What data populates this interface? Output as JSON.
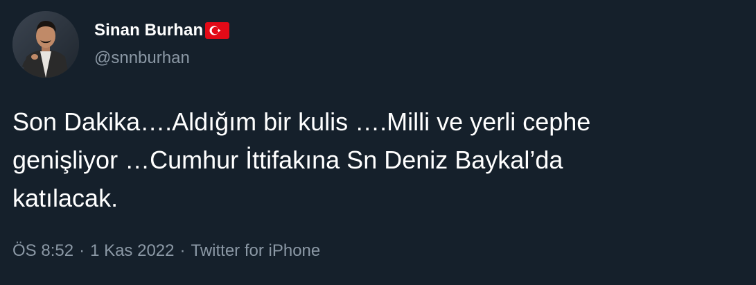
{
  "user": {
    "display_name": "Sinan Burhan",
    "handle": "@snnburhan",
    "name_emoji": "turkey-flag-icon",
    "avatar": "profile-photo"
  },
  "tweet": {
    "lines": [
      "Son Dakika….Aldığım bir kulis ….Milli ve yerli cephe",
      "genişliyor …Cumhur İttifakına Sn Deniz Baykal’da",
      "katılacak."
    ]
  },
  "meta": {
    "time": "ÖS 8:52",
    "separator": "·",
    "date": "1 Kas 2022",
    "source": "Twitter for iPhone"
  },
  "colors": {
    "background": "#15202b",
    "primary_text": "#ffffff",
    "secondary_text": "#8b98a5",
    "flag_red": "#e30a17"
  }
}
